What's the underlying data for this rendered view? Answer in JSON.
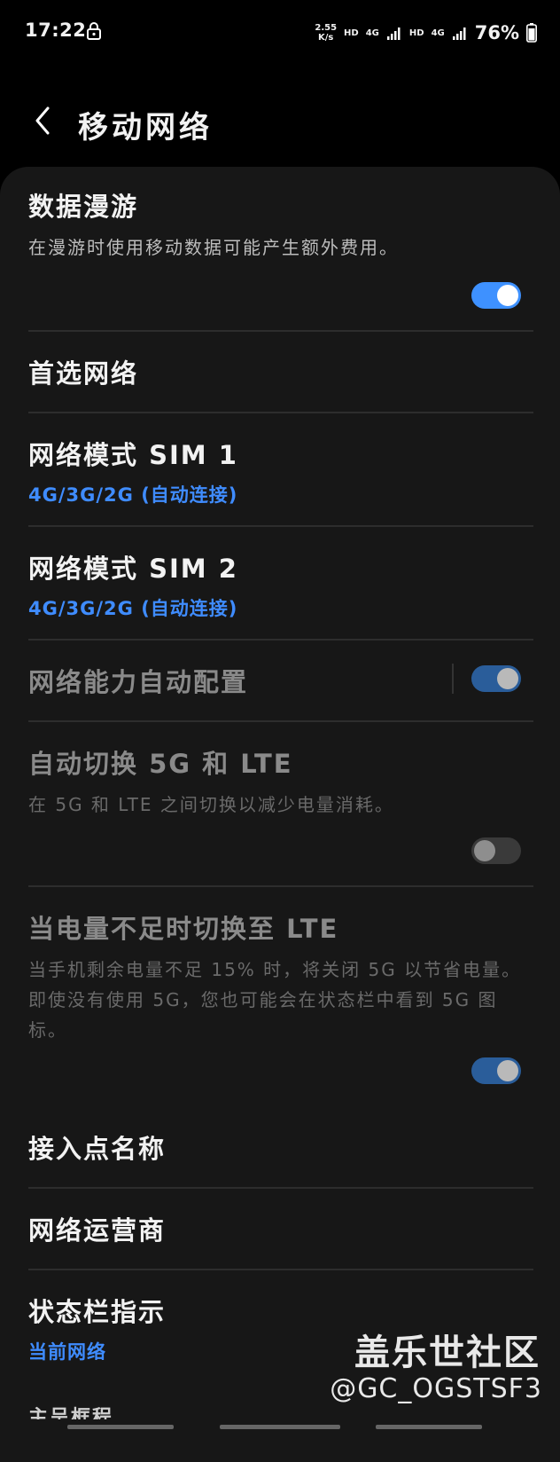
{
  "status_bar": {
    "time": "17:22",
    "speed_value": "2.55",
    "speed_unit": "K/s",
    "hd1": "HD",
    "net1": "4G",
    "hd2": "HD",
    "net2": "4G",
    "battery": "76%",
    "icons": [
      "lock-icon",
      "signal-icon",
      "battery-icon"
    ]
  },
  "header": {
    "title": "移动网络",
    "back_icon": "chevron-left-icon"
  },
  "settings": {
    "data_roaming": {
      "title": "数据漫游",
      "subtitle": "在漫游时使用移动数据可能产生额外费用。",
      "toggle": "on"
    },
    "preferred_network": {
      "title": "首选网络"
    },
    "sim1": {
      "title": "网络模式 SIM 1",
      "value": "4G/3G/2G (自动连接)"
    },
    "sim2": {
      "title": "网络模式 SIM 2",
      "value": "4G/3G/2G (自动连接)"
    },
    "auto_config": {
      "title": "网络能力自动配置",
      "toggle": "on",
      "enabled": false
    },
    "auto_switch": {
      "title": "自动切换 5G 和 LTE",
      "subtitle": "在 5G 和 LTE 之间切换以减少电量消耗。",
      "toggle": "off",
      "enabled": false
    },
    "low_battery": {
      "title": "当电量不足时切换至 LTE",
      "subtitle": "当手机剩余电量不足 15% 时，将关闭 5G 以节省电量。即使没有使用 5G，您也可能会在状态栏中看到 5G 图标。",
      "toggle": "on",
      "enabled": false
    },
    "apn": {
      "title": "接入点名称"
    },
    "operator": {
      "title": "网络运营商"
    },
    "statusbar_indicator": {
      "title": "状态栏指示",
      "value": "当前网络"
    },
    "partial_next": "主呈框程"
  },
  "watermark": {
    "brand": "盖乐世社区",
    "user": "@GC_OGSTSF3"
  },
  "colors": {
    "accent": "#3e91ff",
    "background": "#000000",
    "card": "#171717"
  }
}
